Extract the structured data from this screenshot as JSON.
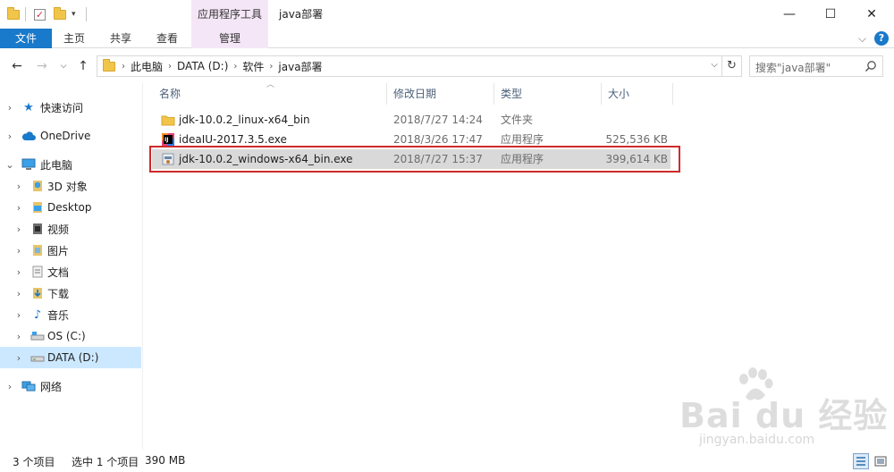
{
  "titlebar": {
    "context_tab": "应用程序工具",
    "window_title": "java部署",
    "minimize": "—",
    "maximize": "☐",
    "close": "✕"
  },
  "ribbon": {
    "tabs": [
      {
        "label": "文件"
      },
      {
        "label": "主页"
      },
      {
        "label": "共享"
      },
      {
        "label": "查看"
      },
      {
        "label": "管理"
      }
    ],
    "expand_glyph": "⌵",
    "help_glyph": "?"
  },
  "address": {
    "crumbs": [
      "此电脑",
      "DATA (D:)",
      "软件",
      "java部署"
    ],
    "search_placeholder": "搜索\"java部署\""
  },
  "navpane": {
    "items": [
      {
        "label": "快速访问",
        "icon": "star-icon"
      },
      {
        "label": "OneDrive",
        "icon": "cloud-icon"
      },
      {
        "label": "此电脑",
        "icon": "computer-icon"
      },
      {
        "label": "3D 对象",
        "icon": "3d-objects-icon"
      },
      {
        "label": "Desktop",
        "icon": "desktop-icon"
      },
      {
        "label": "视频",
        "icon": "video-icon"
      },
      {
        "label": "图片",
        "icon": "pictures-icon"
      },
      {
        "label": "文档",
        "icon": "documents-icon"
      },
      {
        "label": "下载",
        "icon": "download-icon"
      },
      {
        "label": "音乐",
        "icon": "music-icon"
      },
      {
        "label": "OS (C:)",
        "icon": "drive-c-icon"
      },
      {
        "label": "DATA (D:)",
        "icon": "drive-d-icon"
      },
      {
        "label": "网络",
        "icon": "network-icon"
      }
    ]
  },
  "filelist": {
    "columns": {
      "name": "名称",
      "date": "修改日期",
      "type": "类型",
      "size": "大小"
    },
    "rows": [
      {
        "name": "jdk-10.0.2_linux-x64_bin",
        "date": "2018/7/27 14:24",
        "type": "文件夹",
        "size": ""
      },
      {
        "name": "ideaIU-2017.3.5.exe",
        "date": "2018/3/26 17:47",
        "type": "应用程序",
        "size": "525,536 KB"
      },
      {
        "name": "jdk-10.0.2_windows-x64_bin.exe",
        "date": "2018/7/27 15:37",
        "type": "应用程序",
        "size": "399,614 KB"
      }
    ]
  },
  "statusbar": {
    "item_count": "3 个项目",
    "selection": "选中 1 个项目",
    "selection_size": "390 MB"
  },
  "watermark": {
    "logo": "Bai du 经验",
    "url": "jingyan.baidu.com"
  },
  "colors": {
    "accent": "#1979ca",
    "selection": "#cce8ff",
    "highlight_box": "#cf2a2a",
    "context_tab": "#f5e6f7"
  }
}
